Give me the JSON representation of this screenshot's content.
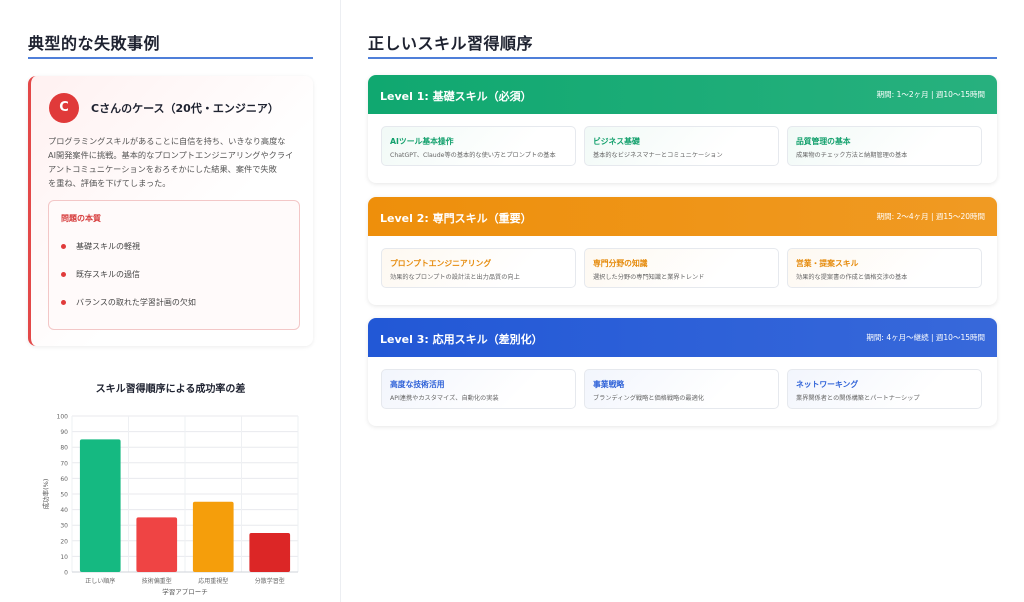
{
  "left": {
    "title": "典型的な失敗事例",
    "case": {
      "avatar": "C",
      "title": "Cさんのケース（20代・エンジニア）",
      "desc_lines": [
        "プログラミングスキルがあることに自信を持ち、いきなり高度な",
        "AI開発案件に挑戦。基本的なプロンプトエンジニアリングやクライ",
        "アントコミュニケーションをおろそかにした結果、案件で失敗",
        "を重ね、評価を下げてしまった。"
      ],
      "issue_title": "問題の本質",
      "issues": [
        "基礎スキルの軽視",
        "既存スキルの過信",
        "バランスの取れた学習計画の欠如"
      ]
    }
  },
  "chart_data": {
    "type": "bar",
    "title": "スキル習得順序による成功率の差",
    "xlabel": "学習アプローチ",
    "ylabel": "成功率(%)",
    "ylim": [
      0,
      100
    ],
    "yticks": [
      "0",
      "10",
      "20",
      "30",
      "40",
      "50",
      "60",
      "70",
      "80",
      "90",
      "100"
    ],
    "categories": [
      "正しい順序",
      "技術偏重型",
      "応用重視型",
      "分散学習型"
    ],
    "values": [
      85,
      35,
      45,
      25
    ],
    "colors": [
      "#15b981",
      "#ef4444",
      "#f59e0b",
      "#dc2626"
    ],
    "grid": true
  },
  "right": {
    "title": "正しいスキル習得順序",
    "levels": [
      {
        "name": "Level 1: 基礎スキル（必須）",
        "period": "期間: 1〜2ヶ月 | 週10〜15時間",
        "color": "#10a870",
        "text_color": "#12a06c",
        "skills": [
          {
            "name": "AIツール基本操作",
            "desc": "ChatGPT、Claude等の基本的な使い方とプロンプトの基本"
          },
          {
            "name": "ビジネス基礎",
            "desc": "基本的なビジネスマナーとコミュニケーション"
          },
          {
            "name": "品質管理の基本",
            "desc": "成果物のチェック方法と納期管理の基本"
          }
        ]
      },
      {
        "name": "Level 2: 専門スキル（重要）",
        "period": "期間: 2〜4ヶ月 | 週15〜20時間",
        "color": "#ee8f0b",
        "text_color": "#e58a0a",
        "skills": [
          {
            "name": "プロンプトエンジニアリング",
            "desc": "効果的なプロンプトの設計法と出力品質の向上"
          },
          {
            "name": "専門分野の知識",
            "desc": "選択した分野の専門知識と業界トレンド"
          },
          {
            "name": "営業・提案スキル",
            "desc": "効果的な提案書の作成と価格交渉の基本"
          }
        ]
      },
      {
        "name": "Level 3: 応用スキル（差別化）",
        "period": "期間: 4ヶ月〜継続 | 週10〜15時間",
        "color": "#2258d6",
        "text_color": "#2f62d8",
        "skills": [
          {
            "name": "高度な技術活用",
            "desc": "API連携やカスタマイズ、自動化の実装"
          },
          {
            "name": "事業戦略",
            "desc": "ブランディング戦略と価格戦略の最適化"
          },
          {
            "name": "ネットワーキング",
            "desc": "業界関係者との関係構築とパートナーシップ"
          }
        ]
      }
    ]
  }
}
